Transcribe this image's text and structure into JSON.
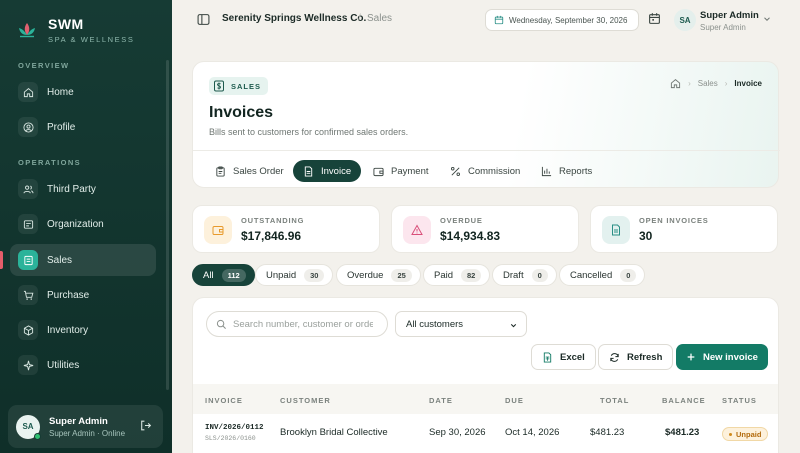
{
  "brand": {
    "name": "SWM",
    "tagline": "SPA & WELLNESS"
  },
  "sidebar": {
    "sections": [
      {
        "label": "OVERVIEW",
        "items": [
          {
            "label": "Home",
            "icon": "home-icon"
          },
          {
            "label": "Profile",
            "icon": "profile-icon"
          }
        ]
      },
      {
        "label": "OPERATIONS",
        "items": [
          {
            "label": "Third Party",
            "icon": "users-icon"
          },
          {
            "label": "Organization",
            "icon": "organization-icon"
          },
          {
            "label": "Sales",
            "icon": "sales-icon",
            "active": true
          },
          {
            "label": "Purchase",
            "icon": "cart-icon"
          },
          {
            "label": "Inventory",
            "icon": "box-icon"
          },
          {
            "label": "Utilities",
            "icon": "sparkle-icon"
          }
        ]
      }
    ],
    "user": {
      "initials": "SA",
      "name": "Super Admin",
      "role": "Super Admin · Online"
    }
  },
  "topbar": {
    "company": "Serenity Springs Wellness Co.",
    "separator": "/",
    "section": "Sales",
    "date": "Wednesday, September 30, 2026",
    "user": {
      "initials": "SA",
      "name": "Super Admin",
      "role": "Super Admin"
    }
  },
  "header": {
    "badge": "SALES",
    "title": "Invoices",
    "subtitle": "Bills sent to customers for confirmed sales orders.",
    "breadcrumb": [
      "Sales",
      "Invoice"
    ],
    "tabs": [
      {
        "label": "Sales Order"
      },
      {
        "label": "Invoice",
        "active": true
      },
      {
        "label": "Payment"
      },
      {
        "label": "Commission"
      },
      {
        "label": "Reports"
      }
    ]
  },
  "stats": [
    {
      "label": "OUTSTANDING",
      "value": "$17,846.96",
      "color": "#e89a2c"
    },
    {
      "label": "OVERDUE",
      "value": "$14,934.83",
      "color": "#d94f7a"
    },
    {
      "label": "OPEN INVOICES",
      "value": "30",
      "color": "#2a8f86"
    }
  ],
  "filters": [
    {
      "label": "All",
      "count": "112",
      "active": true
    },
    {
      "label": "Unpaid",
      "count": "30"
    },
    {
      "label": "Overdue",
      "count": "25"
    },
    {
      "label": "Paid",
      "count": "82"
    },
    {
      "label": "Draft",
      "count": "0"
    },
    {
      "label": "Cancelled",
      "count": "0"
    }
  ],
  "toolbar": {
    "search_placeholder": "Search number, customer or order",
    "customer_filter": "All customers",
    "excel_label": "Excel",
    "refresh_label": "Refresh",
    "new_label": "New invoice"
  },
  "table": {
    "columns": [
      "INVOICE",
      "CUSTOMER",
      "DATE",
      "DUE",
      "TOTAL",
      "BALANCE",
      "STATUS"
    ],
    "rows": [
      {
        "invoice": "INV/2026/0112",
        "order": "SLS/2026/0160",
        "customer": "Brooklyn Bridal Collective",
        "date": "Sep 30, 2026",
        "due": "Oct 14, 2026",
        "total": "$481.23",
        "balance": "$481.23",
        "status": "Unpaid"
      }
    ]
  },
  "colors": {
    "sidebar": "#163b34",
    "accent": "#137b66",
    "active_tab": "#17433a",
    "active_marker": "#e35d6a"
  }
}
